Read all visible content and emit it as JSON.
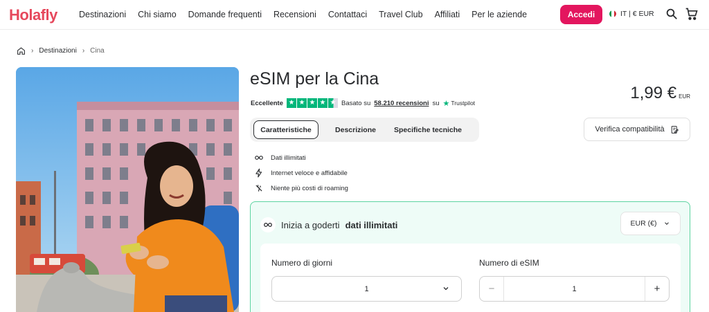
{
  "header": {
    "logo": "Holafly",
    "nav": [
      "Destinazioni",
      "Chi siamo",
      "Domande frequenti",
      "Recensioni",
      "Contattaci",
      "Travel Club",
      "Affiliati",
      "Per le aziende"
    ],
    "login_label": "Accedi",
    "locale": "IT | € EUR",
    "icons": [
      "search-icon",
      "cart-icon"
    ]
  },
  "breadcrumb": {
    "home_icon": "home-icon",
    "items": [
      "Destinazioni",
      "Cina"
    ]
  },
  "product": {
    "title": "eSIM per la Cina",
    "price": "1,99 €",
    "price_currency": "EUR",
    "rating": {
      "label": "Eccellente",
      "stars": 4.5,
      "based_on": "Basato su",
      "reviews": "58.210 recensioni",
      "on": "su",
      "provider": "Trustpilot"
    },
    "tabs": [
      "Caratteristiche",
      "Descrizione",
      "Specifiche tecniche"
    ],
    "active_tab": "Caratteristiche",
    "compat_label": "Verifica compatibilità",
    "features": [
      {
        "icon": "infinity-icon",
        "text": "Dati illimitati"
      },
      {
        "icon": "bolt-icon",
        "text": "Internet veloce e affidabile"
      },
      {
        "icon": "no-roaming-icon",
        "text": "Niente più costi di roaming"
      }
    ]
  },
  "plan": {
    "heading_prefix": "Inizia a goderti",
    "heading_bold": "dati illimitati",
    "currency_select": "EUR (€)",
    "days_label": "Numero di giorni",
    "days_value": "1",
    "esim_label": "Numero di eSIM",
    "esim_value": "1",
    "minus": "−",
    "plus": "+"
  },
  "colors": {
    "brand": "#e3165e",
    "logo": "#e6485c",
    "trustpilot": "#00b67a",
    "plan_bg": "#eefcf7",
    "plan_border": "#5cd4a0"
  }
}
